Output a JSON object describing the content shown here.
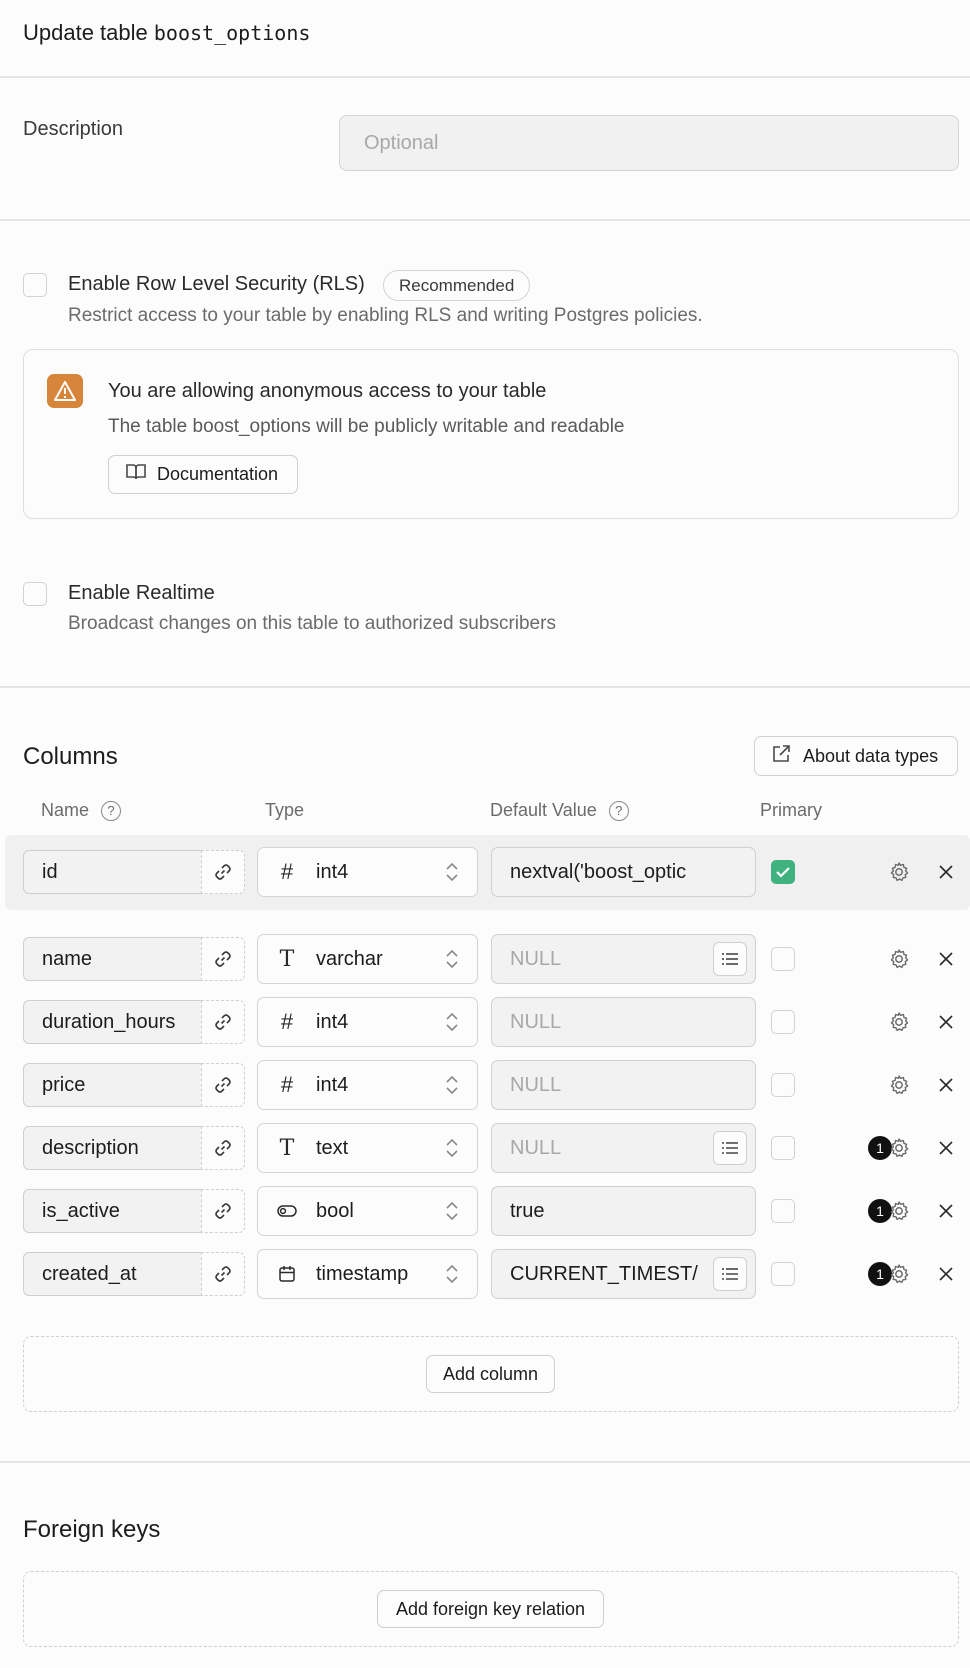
{
  "header": {
    "title_prefix": "Update table",
    "table_name": "boost_options"
  },
  "description": {
    "label": "Description",
    "placeholder": "Optional",
    "value": ""
  },
  "rls": {
    "label": "Enable Row Level Security (RLS)",
    "badge": "Recommended",
    "sub": "Restrict access to your table by enabling RLS and writing Postgres policies.",
    "checked": false
  },
  "warning": {
    "title": "You are allowing anonymous access to your table",
    "text": "The table boost_options will be publicly writable and readable",
    "button": "Documentation",
    "icon": "warning-icon",
    "color": "#d6853a"
  },
  "realtime": {
    "label": "Enable Realtime",
    "sub": "Broadcast changes on this table to authorized subscribers",
    "checked": false
  },
  "columns_section": {
    "title": "Columns",
    "about_button": "About data types",
    "headers": {
      "name": "Name",
      "type": "Type",
      "default": "Default Value",
      "primary": "Primary"
    },
    "help_glyph": "?",
    "add_button": "Add column",
    "rows": [
      {
        "name": "id",
        "type": "int4",
        "type_icon": "#",
        "default": "nextval('boost_optic",
        "default_is_null": false,
        "has_list": false,
        "primary": true,
        "badge": ""
      },
      {
        "name": "name",
        "type": "varchar",
        "type_icon": "T",
        "default": "NULL",
        "default_is_null": true,
        "has_list": true,
        "primary": false,
        "badge": ""
      },
      {
        "name": "duration_hours",
        "type": "int4",
        "type_icon": "#",
        "default": "NULL",
        "default_is_null": true,
        "has_list": false,
        "primary": false,
        "badge": ""
      },
      {
        "name": "price",
        "type": "int4",
        "type_icon": "#",
        "default": "NULL",
        "default_is_null": true,
        "has_list": false,
        "primary": false,
        "badge": ""
      },
      {
        "name": "description",
        "type": "text",
        "type_icon": "T",
        "default": "NULL",
        "default_is_null": true,
        "has_list": true,
        "primary": false,
        "badge": "1"
      },
      {
        "name": "is_active",
        "type": "bool",
        "type_icon": "toggle",
        "default": "true",
        "default_is_null": false,
        "has_list": false,
        "primary": false,
        "badge": "1"
      },
      {
        "name": "created_at",
        "type": "timestamp",
        "type_icon": "calendar",
        "default": "CURRENT_TIMEST/",
        "default_is_null": false,
        "has_list": true,
        "primary": false,
        "badge": "1"
      }
    ]
  },
  "foreign_keys": {
    "title": "Foreign keys",
    "add_button": "Add foreign key relation"
  }
}
